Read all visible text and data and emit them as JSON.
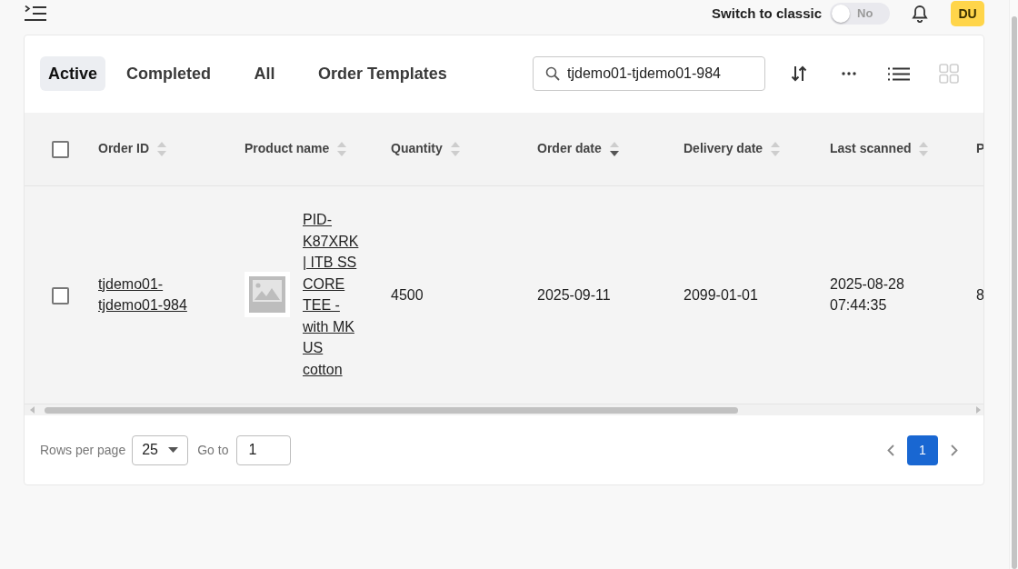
{
  "top_bar": {
    "classic_switch": {
      "label": "Switch to classic",
      "state_text": "No",
      "on": false
    },
    "avatar": {
      "initials": "DU"
    }
  },
  "tabs": [
    {
      "label": "Active",
      "selected": true
    },
    {
      "label": "Completed",
      "selected": false
    },
    {
      "label": "All",
      "selected": false
    },
    {
      "label": "Order Templates",
      "selected": false
    }
  ],
  "search": {
    "value": "tjdemo01-tjdemo01-984"
  },
  "view_modes": [
    {
      "kind": "list",
      "selected": true
    },
    {
      "kind": "grid",
      "selected": false
    }
  ],
  "table": {
    "select_all": {
      "checked": false
    },
    "columns": [
      {
        "label": "Order ID",
        "sortable": true,
        "sorted_desc": false
      },
      {
        "label": "Product name",
        "sortable": true,
        "sorted_desc": false
      },
      {
        "label": "Quantity",
        "sortable": true,
        "sorted_desc": false
      },
      {
        "label": "Order date",
        "sortable": true,
        "sorted_desc": true
      },
      {
        "label": "Delivery date",
        "sortable": true,
        "sorted_desc": false
      },
      {
        "label": "Last scanned",
        "sortable": true,
        "sorted_desc": false
      },
      {
        "label": "P"
      }
    ],
    "rows": [
      {
        "checked": false,
        "cells": [
          {
            "kind": "link",
            "text": "tjdemo01-tjdemo01-984"
          },
          {
            "kind": "product",
            "text": "PID-K87XRK | ITB SS CORE TEE - with MK US cotton"
          },
          {
            "kind": "text",
            "text": "4500"
          },
          {
            "kind": "text",
            "text": "2025-09-11"
          },
          {
            "kind": "text",
            "text": "2099-01-01"
          },
          {
            "kind": "text",
            "text": "2025-08-28 07:44:35"
          },
          {
            "kind": "text",
            "text": "8"
          }
        ]
      }
    ]
  },
  "pagination": {
    "rows_per_page_label": "Rows per page",
    "rows_per_page": "25",
    "go_to_label": "Go to",
    "go_to_value": "1",
    "pages": [
      {
        "label": "1",
        "selected": true
      }
    ]
  }
}
